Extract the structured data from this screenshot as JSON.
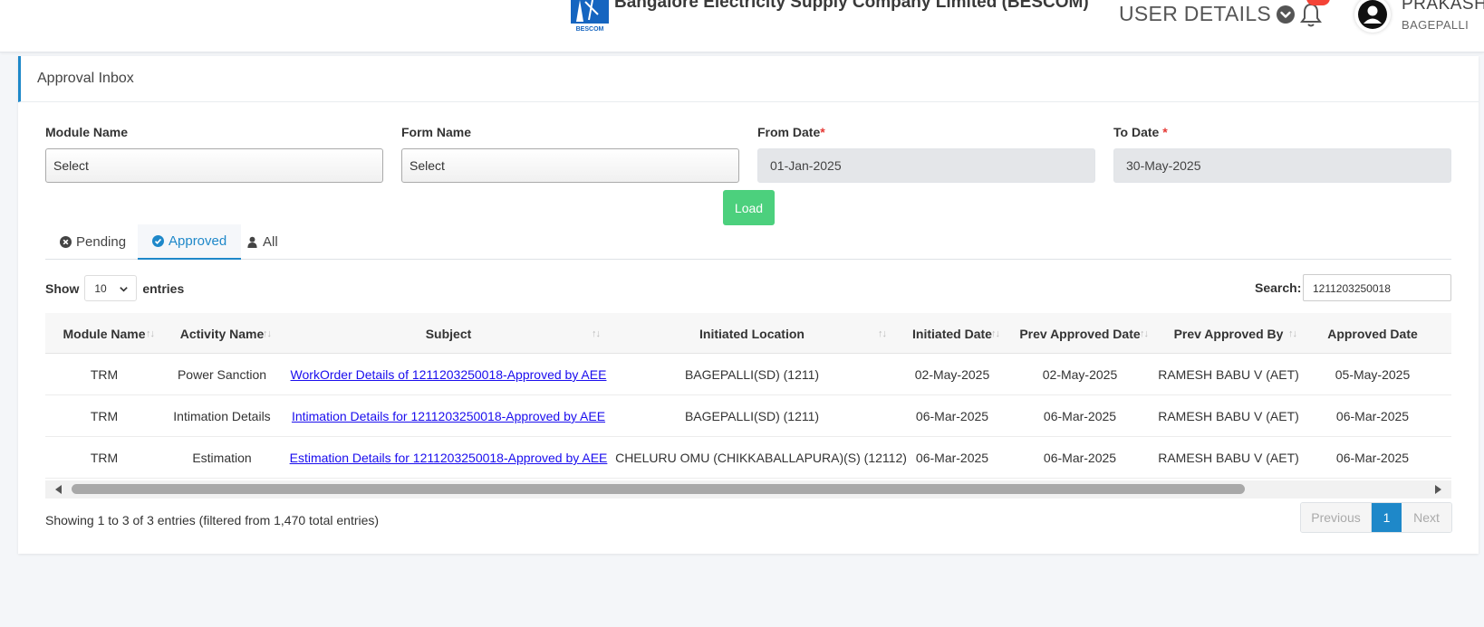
{
  "header": {
    "org_name": "Bangalore Electricity Supply Company Limited (BESCOM)",
    "logo_text": "BESCOM",
    "user_details_label": "USER DETAILS",
    "user_name": "PRAKASH",
    "user_location": "BAGEPALLI"
  },
  "page": {
    "title": "Approval Inbox"
  },
  "filters": {
    "module_label": "Module Name",
    "module_value": "Select",
    "form_label": "Form Name",
    "form_value": "Select",
    "from_label": "From Date",
    "from_value": "01-Jan-2025",
    "to_label": "To Date",
    "to_value": "30-May-2025",
    "required_mark": "*",
    "load_label": "Load"
  },
  "tabs": [
    {
      "label": "Pending",
      "icon": "times-circle-icon",
      "active": false
    },
    {
      "label": "Approved",
      "icon": "check-circle-icon",
      "active": true
    },
    {
      "label": "All",
      "icon": "user-icon",
      "active": false
    }
  ],
  "table_controls": {
    "show_label": "Show",
    "entries_value": "10",
    "entries_label": "entries",
    "search_label": "Search:",
    "search_value": "1211203250018"
  },
  "table": {
    "columns": [
      "Module Name",
      "Activity Name",
      "Subject",
      "Initiated Location",
      "Initiated Date",
      "Prev Approved Date",
      "Prev Approved By",
      "Approved Date"
    ],
    "rows": [
      [
        "TRM",
        "Power Sanction",
        "WorkOrder Details of 1211203250018-Approved by AEE",
        "BAGEPALLI(SD) (1211)",
        "02-May-2025",
        "02-May-2025",
        "RAMESH BABU V (AET)",
        "05-May-2025"
      ],
      [
        "TRM",
        "Intimation Details",
        "Intimation Details for 1211203250018-Approved by AEE",
        "BAGEPALLI(SD) (1211)",
        "06-Mar-2025",
        "06-Mar-2025",
        "RAMESH BABU V (AET)",
        "06-Mar-2025"
      ],
      [
        "TRM",
        "Estimation",
        "Estimation Details for 1211203250018-Approved by AEE",
        "CHELURU OMU (CHIKKABALLAPURA)(S) (12112)",
        "06-Mar-2025",
        "06-Mar-2025",
        "RAMESH BABU V (AET)",
        "06-Mar-2025"
      ]
    ]
  },
  "footer": {
    "info": "Showing 1 to 3 of 3 entries (filtered from 1,470 total entries)",
    "previous_label": "Previous",
    "current_page": "1",
    "next_label": "Next"
  },
  "colors": {
    "accent": "#1e88c9",
    "load_button": "#4cd07d",
    "badge": "#f44336",
    "link": "#1a0dee"
  }
}
